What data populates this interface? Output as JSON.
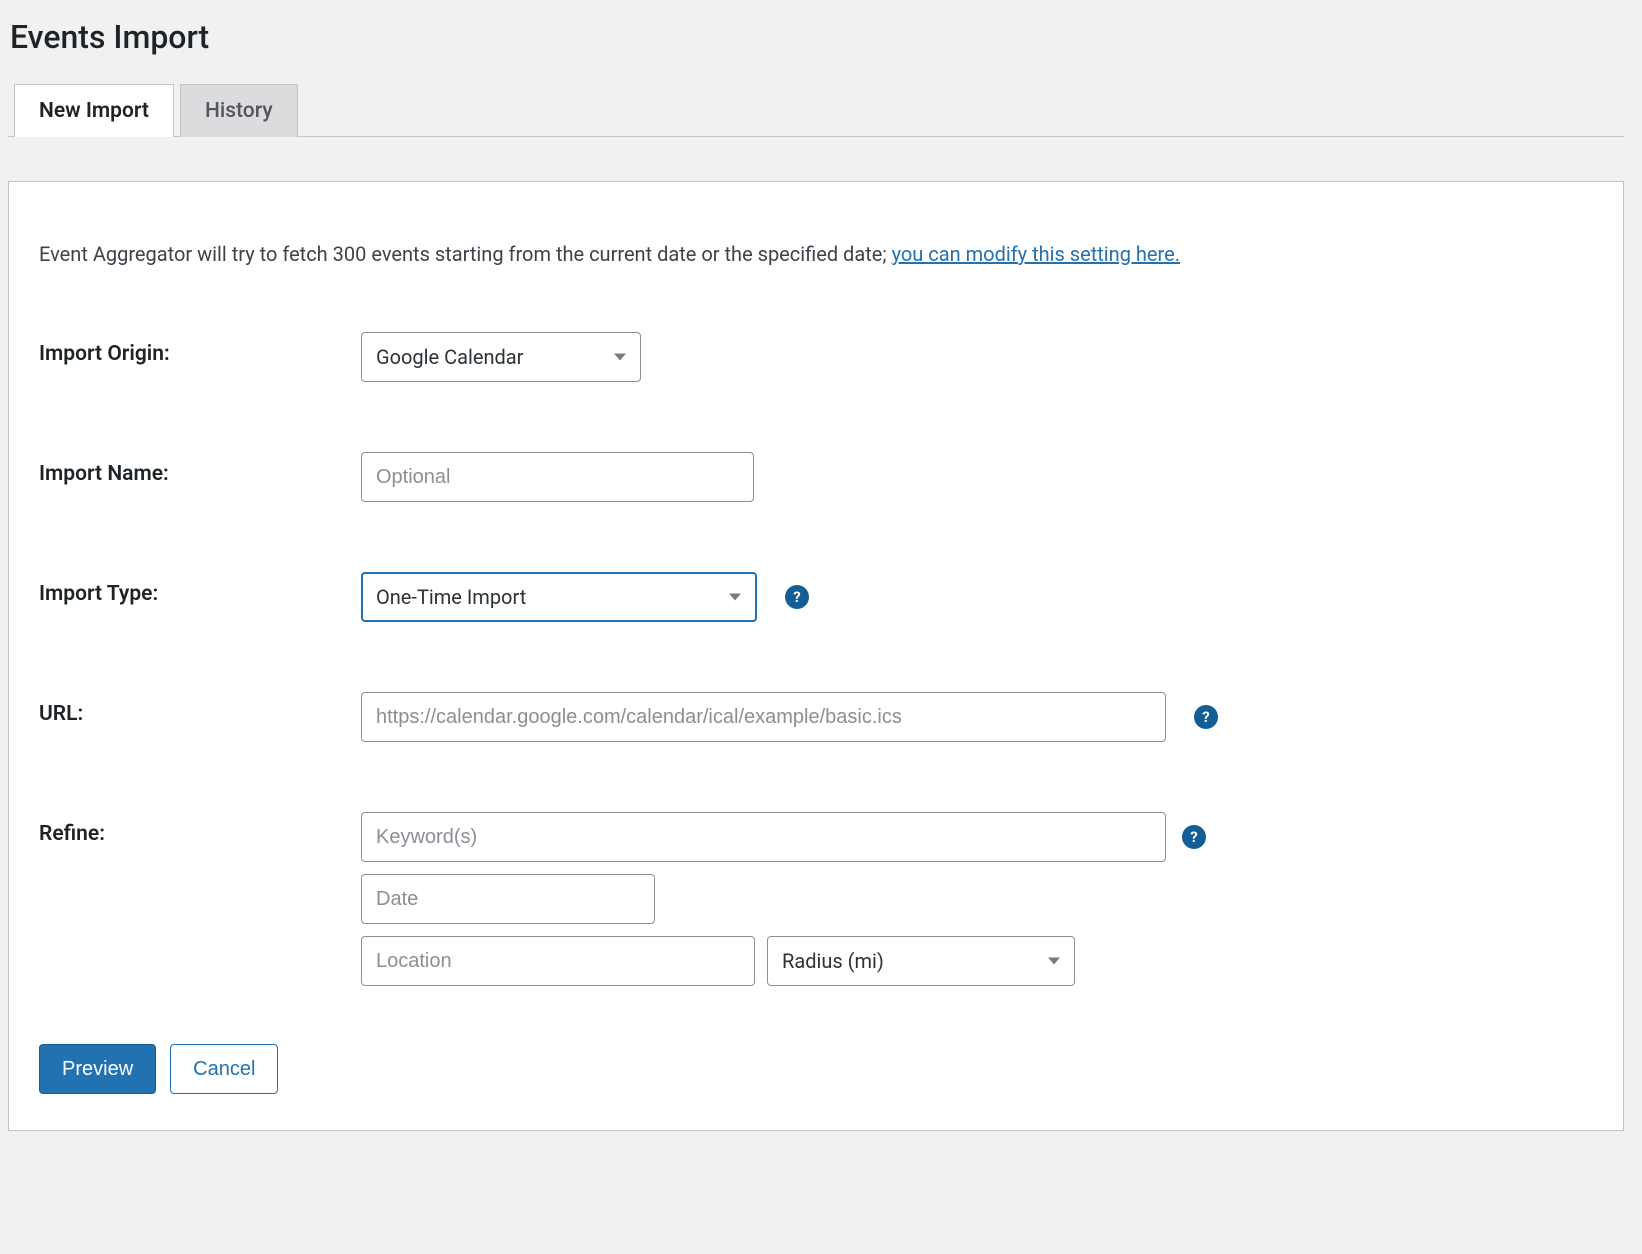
{
  "page": {
    "title": "Events Import"
  },
  "tabs": {
    "new_import": "New Import",
    "history": "History"
  },
  "intro": {
    "text": "Event Aggregator will try to fetch 300 events starting from the current date or the specified date; ",
    "link_text": "you can modify this setting here."
  },
  "labels": {
    "import_origin": "Import Origin:",
    "import_name": "Import Name:",
    "import_type": "Import Type:",
    "url": "URL:",
    "refine": "Refine:"
  },
  "fields": {
    "origin_value": "Google Calendar",
    "name_placeholder": "Optional",
    "type_value": "One-Time Import",
    "url_placeholder": "https://calendar.google.com/calendar/ical/example/basic.ics",
    "keywords_placeholder": "Keyword(s)",
    "date_placeholder": "Date",
    "location_placeholder": "Location",
    "radius_value": "Radius (mi)"
  },
  "buttons": {
    "preview": "Preview",
    "cancel": "Cancel"
  },
  "help_glyph": "?"
}
